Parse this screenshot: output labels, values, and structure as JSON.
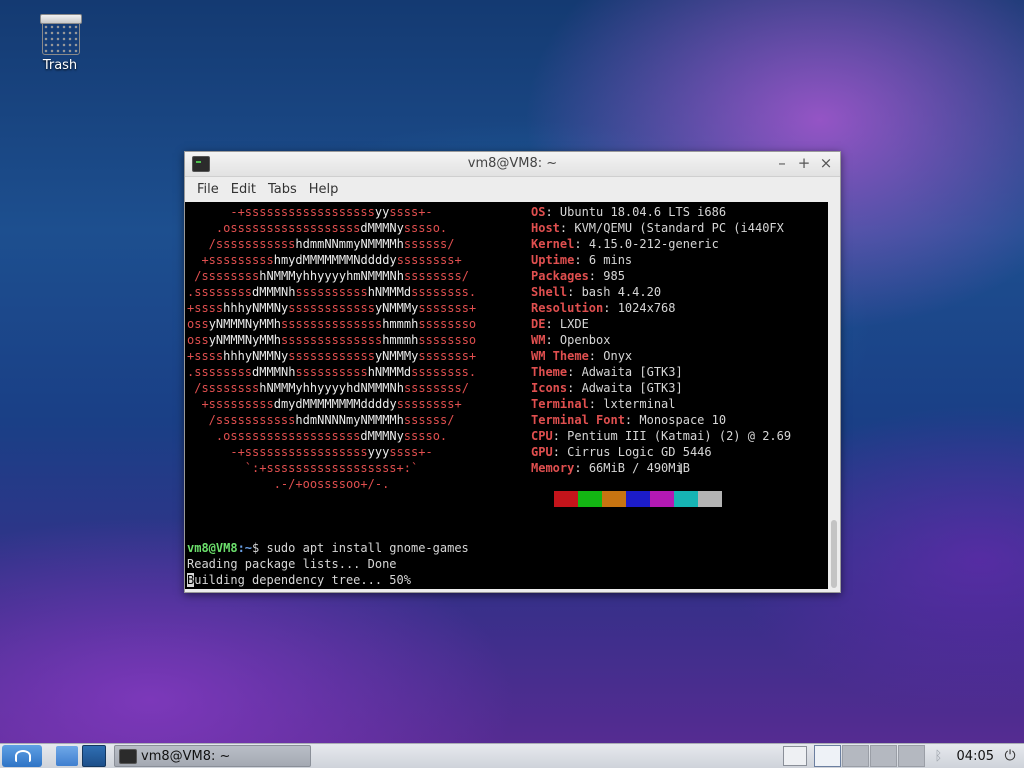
{
  "desktop": {
    "trash_label": "Trash"
  },
  "window": {
    "title": "vm8@VM8: ~",
    "controls": {
      "minimize": "–",
      "maximize": "+",
      "close": "×"
    },
    "menu": [
      "File",
      "Edit",
      "Tabs",
      "Help"
    ]
  },
  "terminal": {
    "logo_lines": [
      "      -+ssssssssssssssssssyyssss+-",
      "    .ossssssssssssssssssdMMMNysssso.",
      "   /ssssssssssshdmmNNmmyNMMMMhssssss/",
      "  +ssssssssshmydMMMMMMMNddddyssssssss+",
      " /sssssssshNMMMyhhyyyyhmNMMMNhssssssss/",
      ".ssssssssdMMMNhsssssssssshNMMMdssssssss.",
      "+sssshhhyNMMNyssssssssssssyNMMMysssssss+",
      "ossyNMMMNyMMhsssssssssssssshmmmhssssssso",
      "ossyNMMMNyMMhsssssssssssssshmmmhssssssso",
      "+sssshhhyNMMNyssssssssssssyNMMMysssssss+",
      ".ssssssssdMMMNhsssssssssshNMMMdssssssss.",
      " /sssssssshNMMMyhhyyyyhdNMMMNhssssssss/",
      "  +sssssssssdmydMMMMMMMMddddyssssssss+",
      "   /ssssssssssshdmNNNNmyNMMMMhssssss/",
      "    .ossssssssssssssssssdMMMNysssso.",
      "      -+sssssssssssssssssyyyssss+-",
      "        `:+ssssssssssssssssss+:`",
      "            .-/+oossssoo+/-."
    ],
    "info": [
      {
        "key": "OS",
        "value": "Ubuntu 18.04.6 LTS i686"
      },
      {
        "key": "Host",
        "value": "KVM/QEMU (Standard PC (i440FX"
      },
      {
        "key": "Kernel",
        "value": "4.15.0-212-generic"
      },
      {
        "key": "Uptime",
        "value": "6 mins"
      },
      {
        "key": "Packages",
        "value": "985"
      },
      {
        "key": "Shell",
        "value": "bash 4.4.20"
      },
      {
        "key": "Resolution",
        "value": "1024x768"
      },
      {
        "key": "DE",
        "value": "LXDE"
      },
      {
        "key": "WM",
        "value": "Openbox"
      },
      {
        "key": "WM Theme",
        "value": "Onyx"
      },
      {
        "key": "Theme",
        "value": "Adwaita [GTK3]"
      },
      {
        "key": "Icons",
        "value": "Adwaita [GTK3]"
      },
      {
        "key": "Terminal",
        "value": "lxterminal"
      },
      {
        "key": "Terminal Font",
        "value": "Monospace 10"
      },
      {
        "key": "CPU",
        "value": "Pentium III (Katmai) (2) @ 2.69"
      },
      {
        "key": "GPU",
        "value": "Cirrus Logic GD 5446"
      },
      {
        "key": "Memory",
        "value": "66MiB / 490MiB"
      }
    ],
    "palette": [
      "#c4141b",
      "#13b613",
      "#c77411",
      "#1c1cc9",
      "#b419b4",
      "#16b4b4",
      "#b4b4b4"
    ],
    "prompt_user": "vm8@VM8",
    "prompt_path": ":~",
    "prompt_symbol": "$ ",
    "command": "sudo apt install gnome-games",
    "output": [
      "Reading package lists... Done"
    ],
    "cursor_char": "B",
    "progress_line_rest": "uilding dependency tree... 50%"
  },
  "taskbar": {
    "task_title": "vm8@VM8: ~",
    "clock": "04:05"
  }
}
